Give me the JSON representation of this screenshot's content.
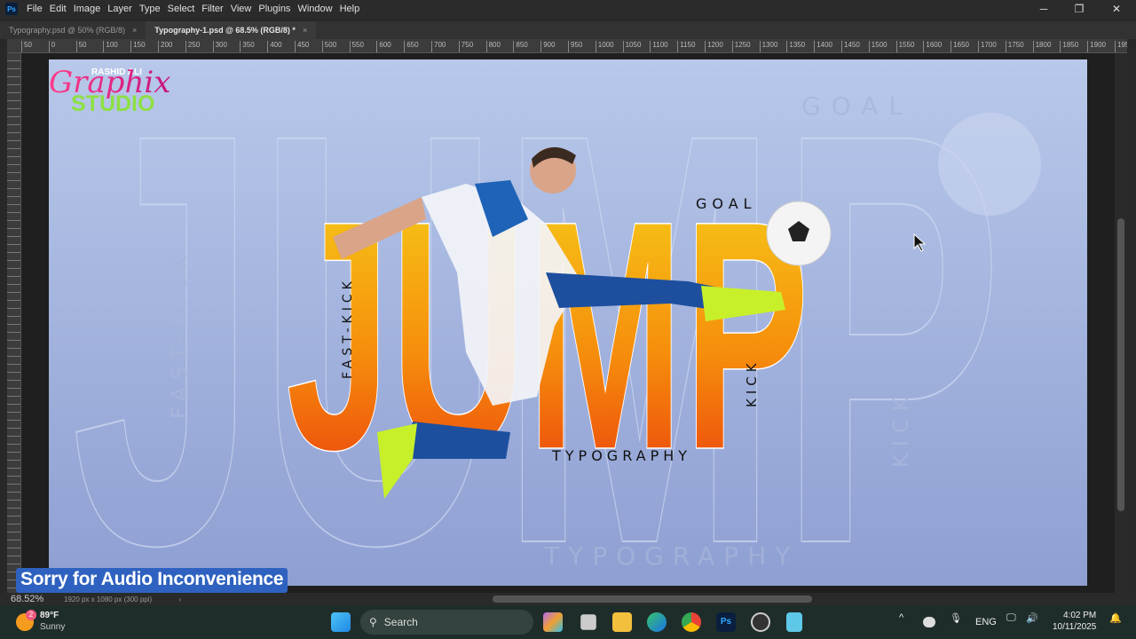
{
  "app": {
    "logo": "Ps",
    "menu": [
      "File",
      "Edit",
      "Image",
      "Layer",
      "Type",
      "Select",
      "Filter",
      "View",
      "Plugins",
      "Window",
      "Help"
    ]
  },
  "window_controls": {
    "minimize": "─",
    "maximize": "❐",
    "close": "✕"
  },
  "tabs": [
    {
      "label": "Typography.psd @ 50% (RGB/8)",
      "active": false
    },
    {
      "label": "Typography-1.psd @ 68.5% (RGB/8) *",
      "active": true
    }
  ],
  "ruler_labels": [
    "50",
    "0",
    "50",
    "100",
    "150",
    "200",
    "250",
    "300",
    "350",
    "400",
    "450",
    "500",
    "550",
    "600",
    "650",
    "700",
    "750",
    "800",
    "850",
    "900",
    "950",
    "1000",
    "1050",
    "1100",
    "1150",
    "1200",
    "1250",
    "1300",
    "1350",
    "1400",
    "1450",
    "1500",
    "1550",
    "1600",
    "1650",
    "1700",
    "1750",
    "1800",
    "1850",
    "1900",
    "1950"
  ],
  "poster": {
    "logo": {
      "top": "RASHID ALI",
      "script": "Graphix",
      "bottom": "STUDIO"
    },
    "main_word": "JUMP",
    "goal": "GOAL",
    "typography": "TYPOGRAPHY",
    "fast_kick": "FAST-KICK",
    "kick": "KICK",
    "colors": {
      "background": "#b4c3e6",
      "gradient_top": "#f5d016",
      "gradient_bottom": "#ea3a0c"
    }
  },
  "status": {
    "zoom": "68.52%",
    "doc_info": "1920 px x 1080 px (300 ppi)",
    "arrow": "›"
  },
  "banner": "Sorry for Audio Inconvenience",
  "taskbar": {
    "weather": {
      "temp": "89°F",
      "condition": "Sunny",
      "badge": "2"
    },
    "search_placeholder": "Search",
    "icons": [
      "start-icon",
      "copilot-icon",
      "task-view-icon",
      "file-explorer-icon",
      "edge-icon",
      "chrome-icon",
      "photoshop-icon",
      "obs-icon",
      "notepad-icon"
    ],
    "tray": {
      "chevron": "^",
      "language": "ENG",
      "time": "4:02 PM",
      "date": "10/11/2025"
    }
  }
}
